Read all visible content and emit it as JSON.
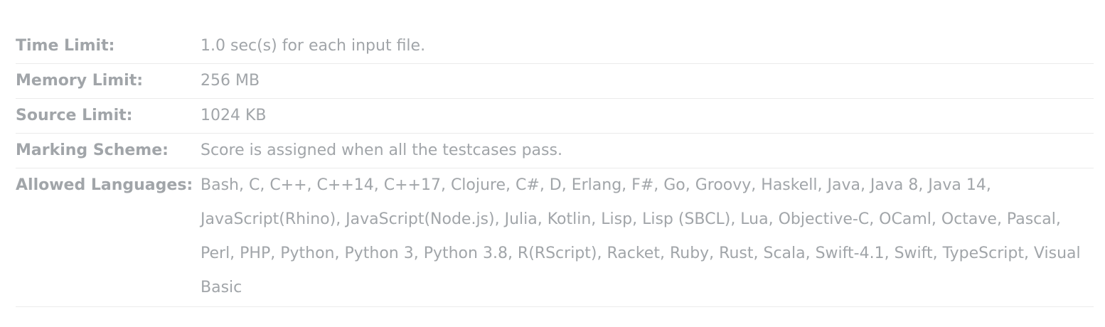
{
  "details": {
    "rows": [
      {
        "label": "Time Limit:",
        "value": "1.0 sec(s) for each input file."
      },
      {
        "label": "Memory Limit:",
        "value": "256 MB"
      },
      {
        "label": "Source Limit:",
        "value": "1024 KB"
      },
      {
        "label": "Marking Scheme:",
        "value": "Score is assigned when all the testcases pass."
      },
      {
        "label": "Allowed Languages:",
        "value": "Bash, C, C++, C++14, C++17, Clojure, C#, D, Erlang, F#, Go, Groovy, Haskell, Java, Java 8, Java 14, JavaScript(Rhino), JavaScript(Node.js), Julia, Kotlin, Lisp, Lisp (SBCL), Lua, Objective-C, OCaml, Octave, Pascal, Perl, PHP, Python, Python 3, Python 3.8, R(RScript), Racket, Ruby, Rust, Scala, Swift-4.1, Swift, TypeScript, Visual Basic"
      }
    ]
  }
}
